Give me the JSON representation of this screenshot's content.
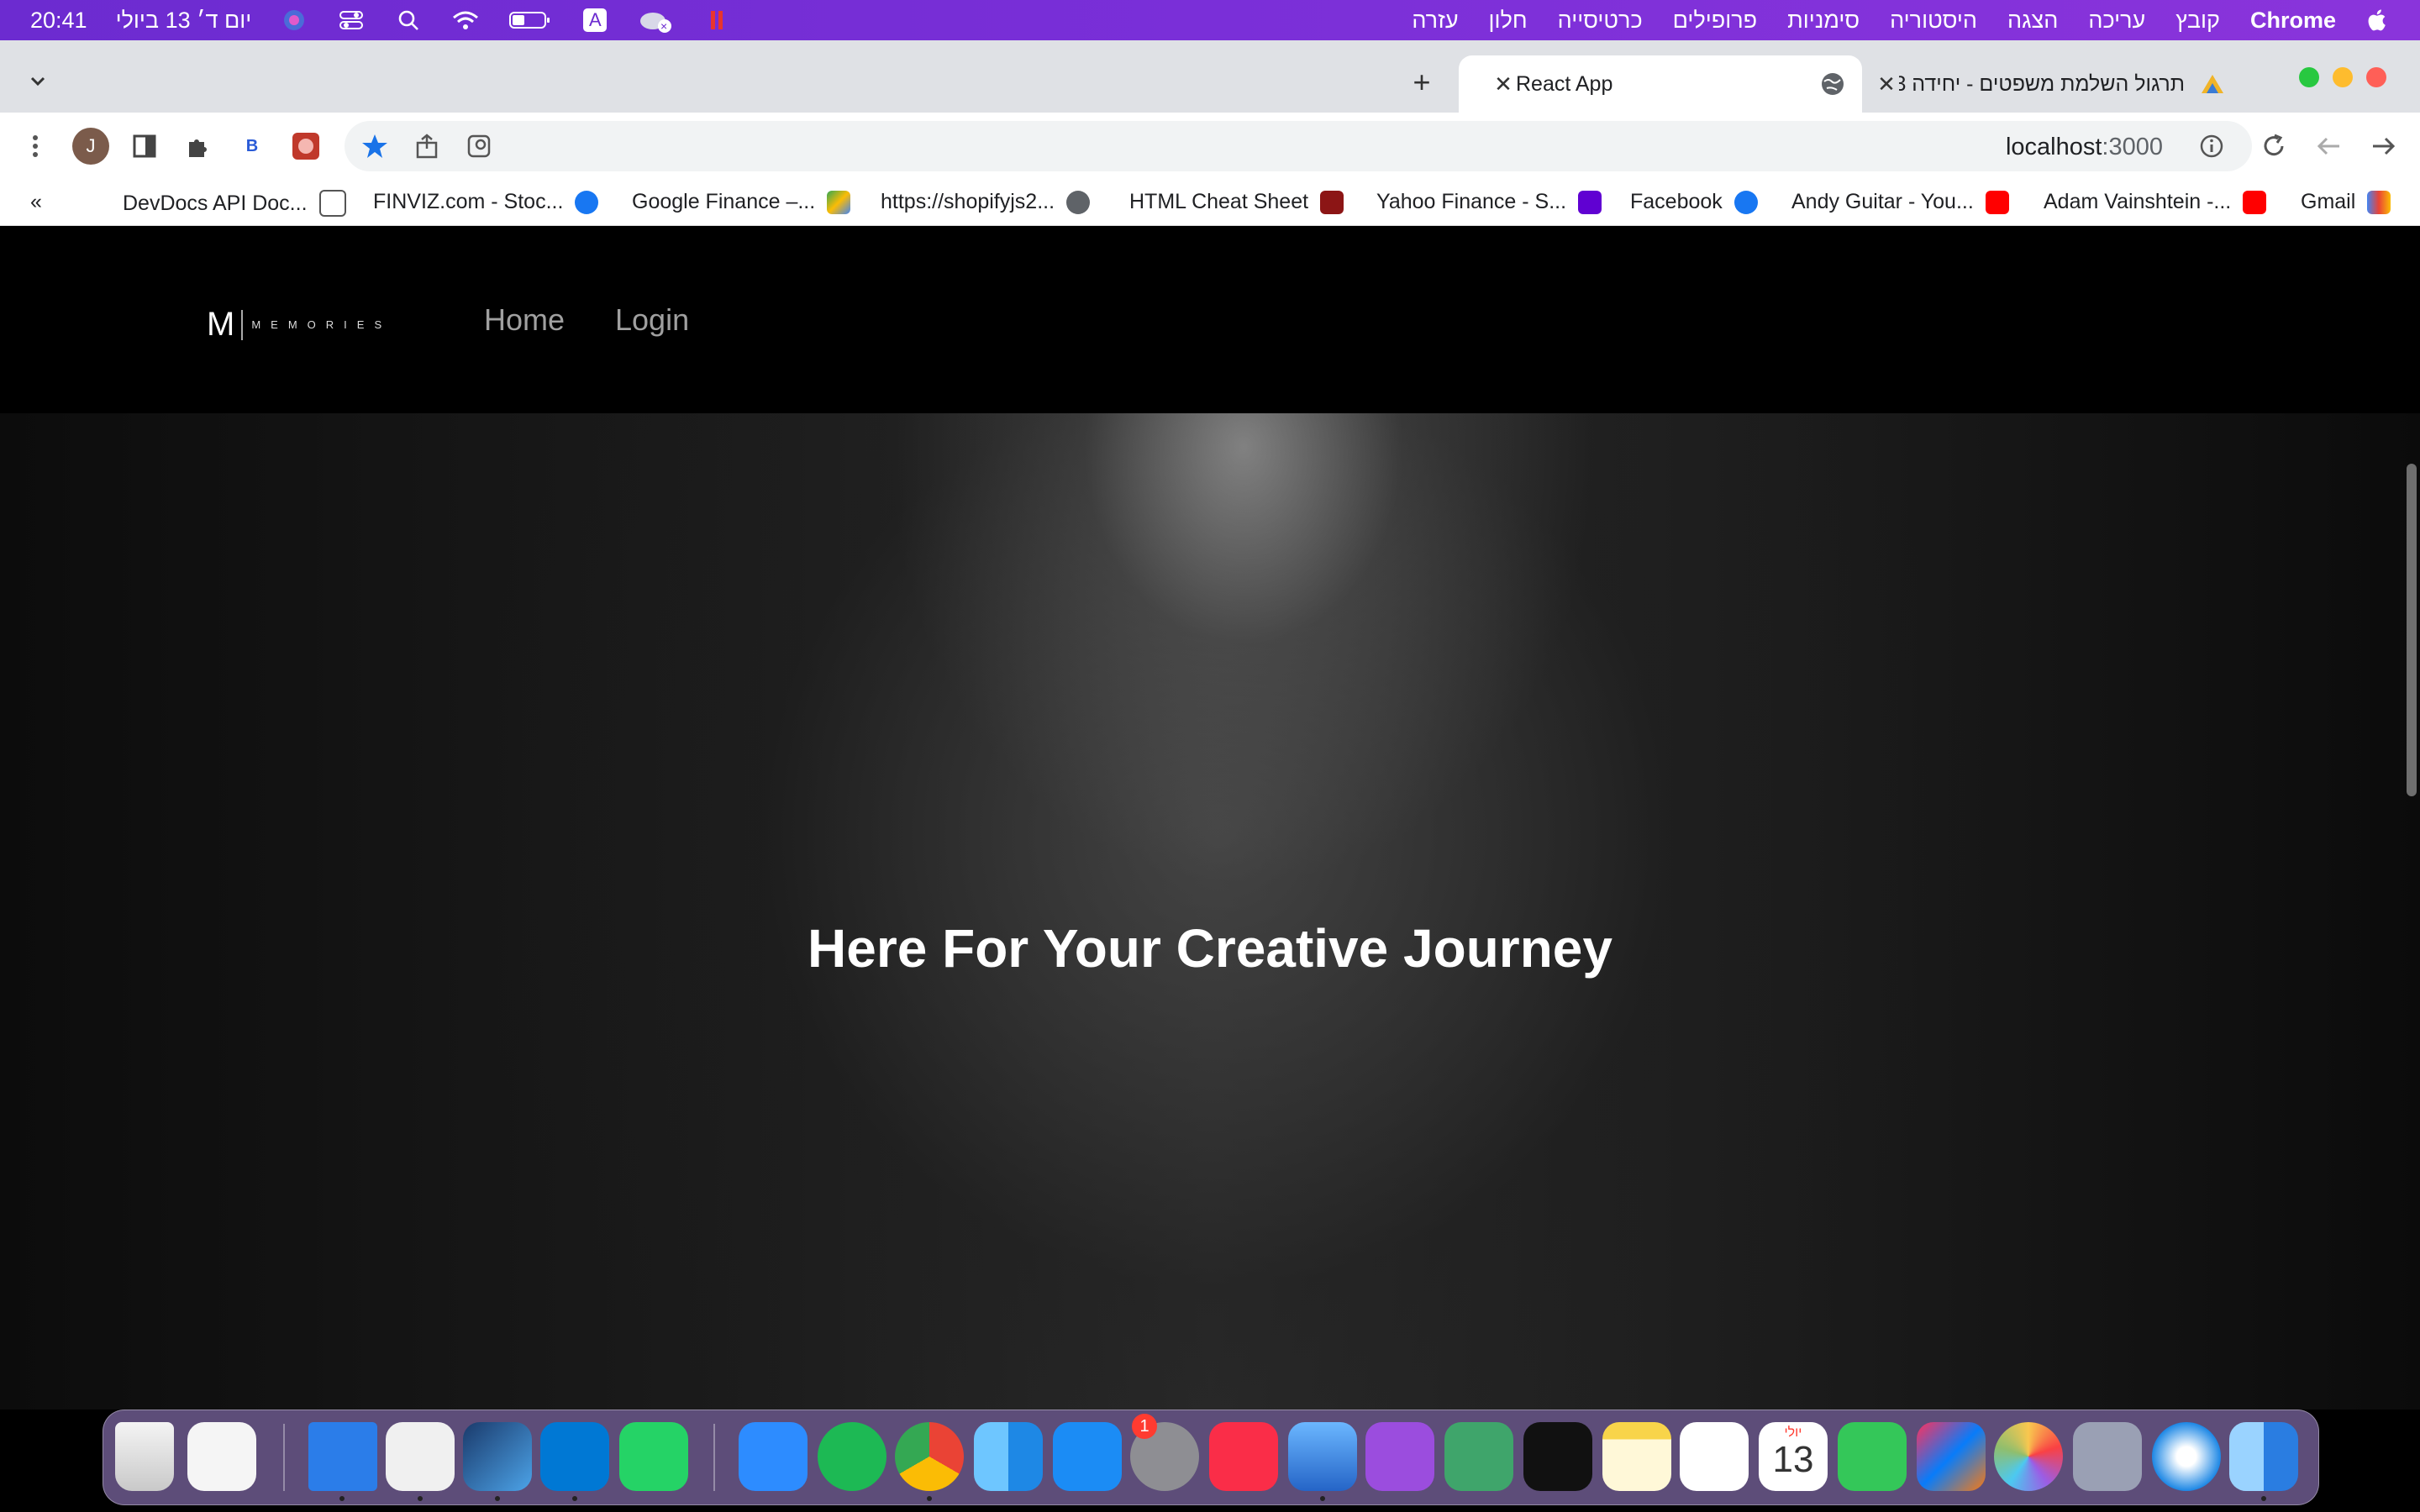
{
  "menubar": {
    "app": "Chrome",
    "items": [
      "קובץ",
      "עריכה",
      "הצגה",
      "היסטוריה",
      "סימניות",
      "פרופילים",
      "כרטיסייה",
      "חלון",
      "עזרה"
    ],
    "clock": "20:41",
    "date": "יום ד׳ 13 ביולי",
    "input_source": "A"
  },
  "tabs": [
    {
      "title": "תרגול השלמת משפטים - יחידה 3"
    },
    {
      "title": "React App"
    }
  ],
  "toolbar": {
    "url_host": "localhost",
    "url_port": ":3000",
    "avatar_letter": "J",
    "ext_b_label": "B"
  },
  "bookmarks": [
    {
      "label": "Gmail"
    },
    {
      "label": "Adam Vainshtein -..."
    },
    {
      "label": "Andy Guitar - You..."
    },
    {
      "label": "Facebook"
    },
    {
      "label": "Yahoo Finance - S..."
    },
    {
      "label": "HTML Cheat Sheet"
    },
    {
      "label": "https://shopifyjs2..."
    },
    {
      "label": "Google Finance –..."
    },
    {
      "label": "FINVIZ.com - Stoc..."
    },
    {
      "label": "DevDocs API Doc..."
    }
  ],
  "bookmarks_overflow": "«",
  "site": {
    "logo_letter": "M",
    "logo_text": "MEMORIES",
    "nav": [
      "Home",
      "Login"
    ],
    "hero_title": "Here For Your Creative Journey"
  },
  "dock": {
    "calendar_month": "יולי",
    "calendar_day": "13",
    "settings_badge": "1"
  }
}
